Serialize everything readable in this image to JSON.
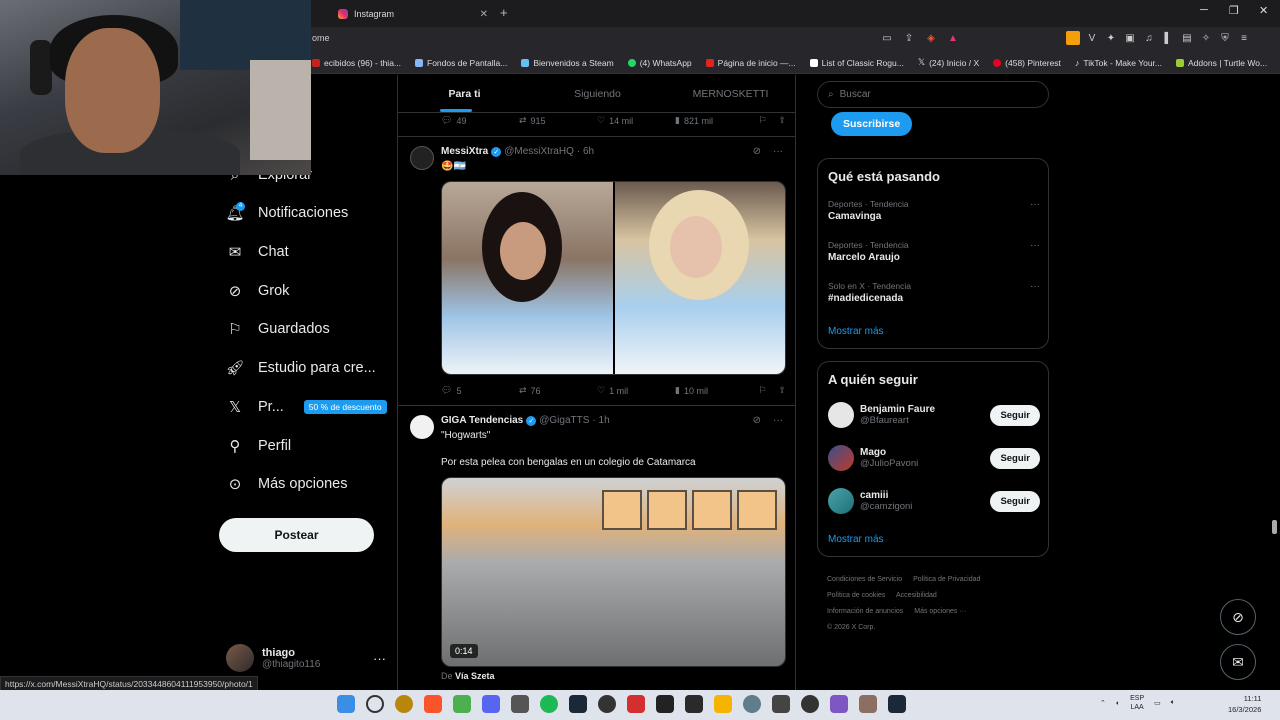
{
  "browser": {
    "tab_title": "Instagram",
    "address": "ome",
    "bookmarks": [
      {
        "label": "ecibidos (96) - thia...",
        "color": "#c5221f"
      },
      {
        "label": "Fondos de Pantalla...",
        "color": "#8ab4f8"
      },
      {
        "label": "Bienvenidos a Steam",
        "color": "#66c0f4"
      },
      {
        "label": "(4) WhatsApp",
        "color": "#25d366"
      },
      {
        "label": "Página de inicio —...",
        "color": "#e02424"
      },
      {
        "label": "List of Classic Rogu...",
        "color": "#ffffff"
      },
      {
        "label": "(24) Inicio / X",
        "color": "#ffffff"
      },
      {
        "label": "(458) Pinterest",
        "color": "#e60023"
      },
      {
        "label": "TikTok - Make Your...",
        "color": "#ffffff"
      },
      {
        "label": "Addons | Turtle Wo...",
        "color": "#9acd32"
      }
    ]
  },
  "nav": {
    "partial_item": "Explorar",
    "items": [
      {
        "label": "Notificaciones",
        "icon": "bell-icon"
      },
      {
        "label": "Chat",
        "icon": "mail-icon"
      },
      {
        "label": "Grok",
        "icon": "grok-icon"
      },
      {
        "label": "Guardados",
        "icon": "bookmark-icon"
      },
      {
        "label": "Estudio para cre...",
        "icon": "rocket-icon"
      },
      {
        "label": "Pr...",
        "icon": "x-logo-icon"
      },
      {
        "label": "Perfil",
        "icon": "person-icon"
      },
      {
        "label": "Más opciones",
        "icon": "more-circle-icon"
      }
    ],
    "notif_badge": "4",
    "promo": "50 % de descuento",
    "post_label": "Postear"
  },
  "profile": {
    "name": "thiago",
    "handle": "@thiagito116",
    "more": "···"
  },
  "timeline": {
    "tabs": [
      "Para ti",
      "Siguiendo",
      "MERNOSKETTI"
    ],
    "prev_actions": {
      "replies": "49",
      "reposts": "915",
      "likes": "14 mil",
      "views": "821 mil"
    },
    "tweet1": {
      "name": "MessiXtra",
      "handle": "@MessiXtraHQ",
      "time": "· 6h",
      "text": "🤩🇦🇷",
      "actions": {
        "replies": "5",
        "reposts": "76",
        "likes": "1 mil",
        "views": "10 mil"
      }
    },
    "tweet2": {
      "name": "GIGA Tendencias",
      "handle": "@GigaTTS",
      "time": "· 1h",
      "quote": "\"Hogwarts\"",
      "text": "Por esta pelea con bengalas en un colegio de Catamarca",
      "duration": "0:14",
      "via_prefix": "De",
      "via_name": "Vía Szeta"
    }
  },
  "right": {
    "search_placeholder": "Buscar",
    "subscribe": "Suscribirse",
    "trends_title": "Qué está pasando",
    "trends": [
      {
        "category": "Deportes · Tendencia",
        "title": "Camavinga"
      },
      {
        "category": "Deportes · Tendencia",
        "title": "Marcelo Araujo"
      },
      {
        "category": "Solo en X · Tendencia",
        "title": "#nadiedicenada"
      }
    ],
    "show_more": "Mostrar más",
    "follow_title": "A quién seguir",
    "follows": [
      {
        "name": "Benjamin Faure",
        "handle": "@Bfaureart",
        "button": "Seguir"
      },
      {
        "name": "Mago",
        "handle": "@JulioPavoni",
        "button": "Seguir"
      },
      {
        "name": "camiii",
        "handle": "@camzigoni",
        "button": "Seguir"
      }
    ],
    "footer": [
      "Condiciones de Servicio",
      "Política de Privacidad",
      "Política de cookies",
      "Accesibilidad",
      "Información de anuncios",
      "Más opciones ···",
      "© 2026 X Corp."
    ]
  },
  "status_url": "https://x.com/MessiXtraHQ/status/2033448604111953950/photo/1",
  "system": {
    "lang1": "ESP",
    "lang2": "LAA",
    "time": "11:11",
    "date": "16/3/2026"
  }
}
